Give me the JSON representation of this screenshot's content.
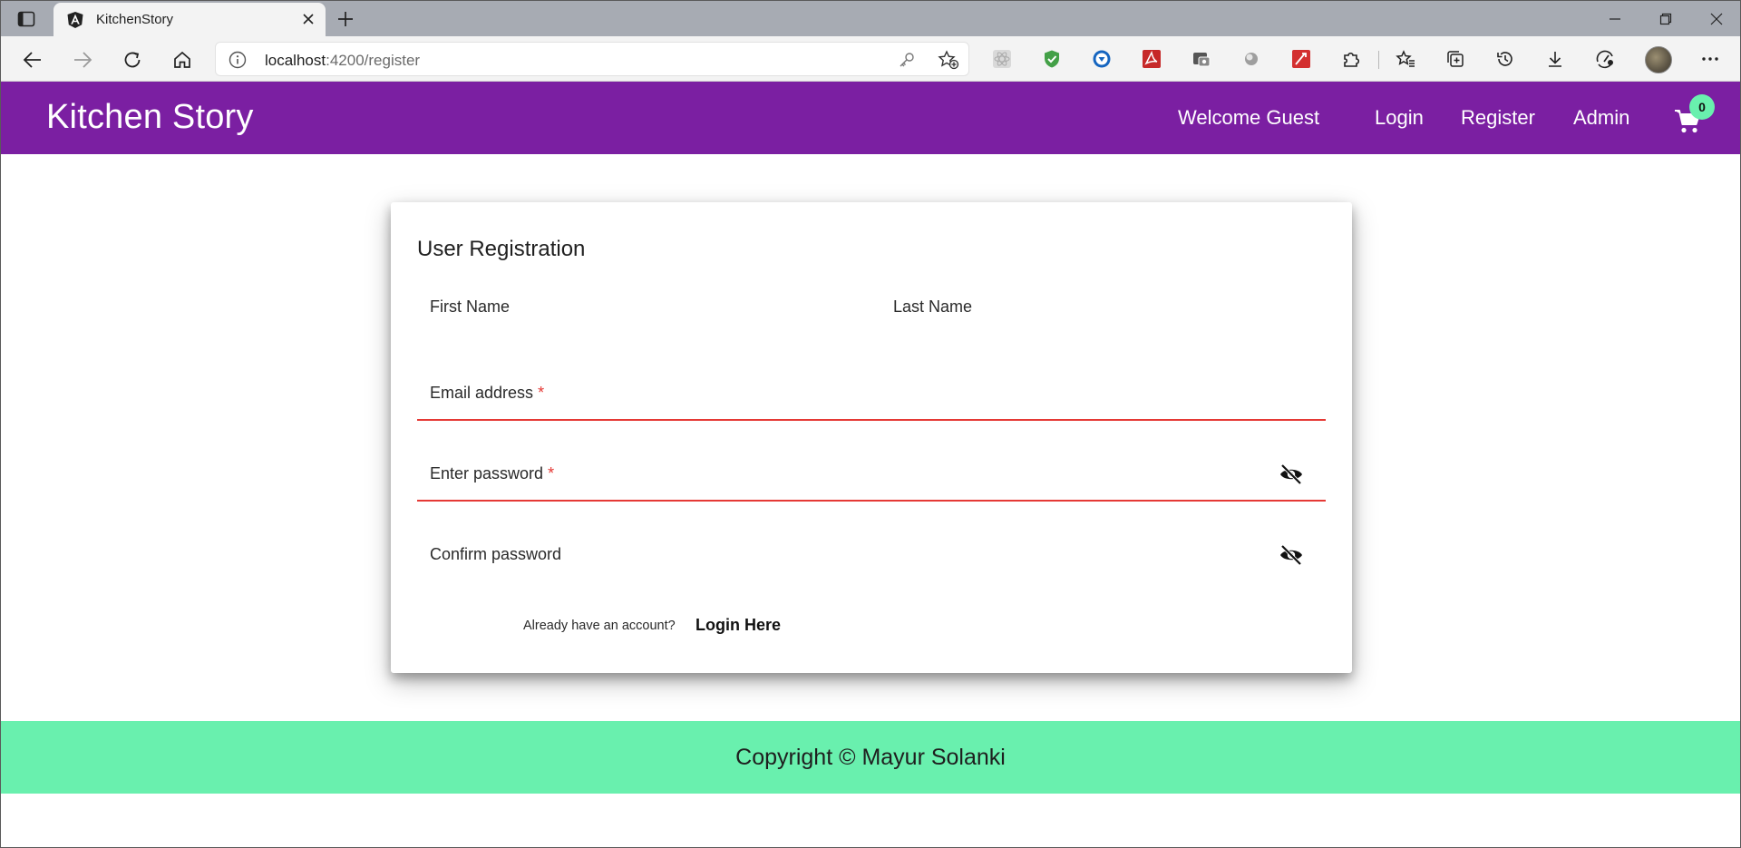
{
  "browser": {
    "tab_title": "KitchenStory",
    "url_host": "localhost",
    "url_path": ":4200/register",
    "icons": {
      "tab_actions": "tab-actions-icon",
      "favicon": "angular-icon",
      "close": "close-icon",
      "new_tab": "plus-icon",
      "back": "back-arrow-icon",
      "forward": "forward-arrow-icon",
      "refresh": "refresh-icon",
      "home": "home-icon",
      "info": "info-icon",
      "key": "key-icon",
      "add_favorite": "star-plus-icon",
      "extensions": [
        "react-devtools-icon",
        "shield-icon",
        "download-helper-icon",
        "pdf-icon",
        "capture-icon",
        "circle-icon",
        "ink-icon",
        "puzzle-icon"
      ],
      "favorites": "favorites-icon",
      "collections": "collections-icon",
      "history": "history-icon",
      "downloads": "download-icon",
      "performance": "performance-icon",
      "more": "more-icon"
    }
  },
  "header": {
    "brand": "Kitchen Story",
    "nav": {
      "welcome": "Welcome Guest",
      "login": "Login",
      "register": "Register",
      "admin": "Admin"
    },
    "cart_count": "0",
    "colors": {
      "background": "#7b1fa2",
      "badge": "#69f0ae"
    }
  },
  "form": {
    "title": "User Registration",
    "first_name_label": "First Name",
    "last_name_label": "Last Name",
    "email_label": "Email address",
    "password_label": "Enter password",
    "confirm_label": "Confirm password",
    "required_marker": "*",
    "account_prompt": "Already have an account?",
    "login_link": "Login Here",
    "colors": {
      "error": "#e53935"
    }
  },
  "footer": {
    "copyright": "Copyright © Mayur Solanki",
    "colors": {
      "background": "#69f0ae"
    }
  }
}
